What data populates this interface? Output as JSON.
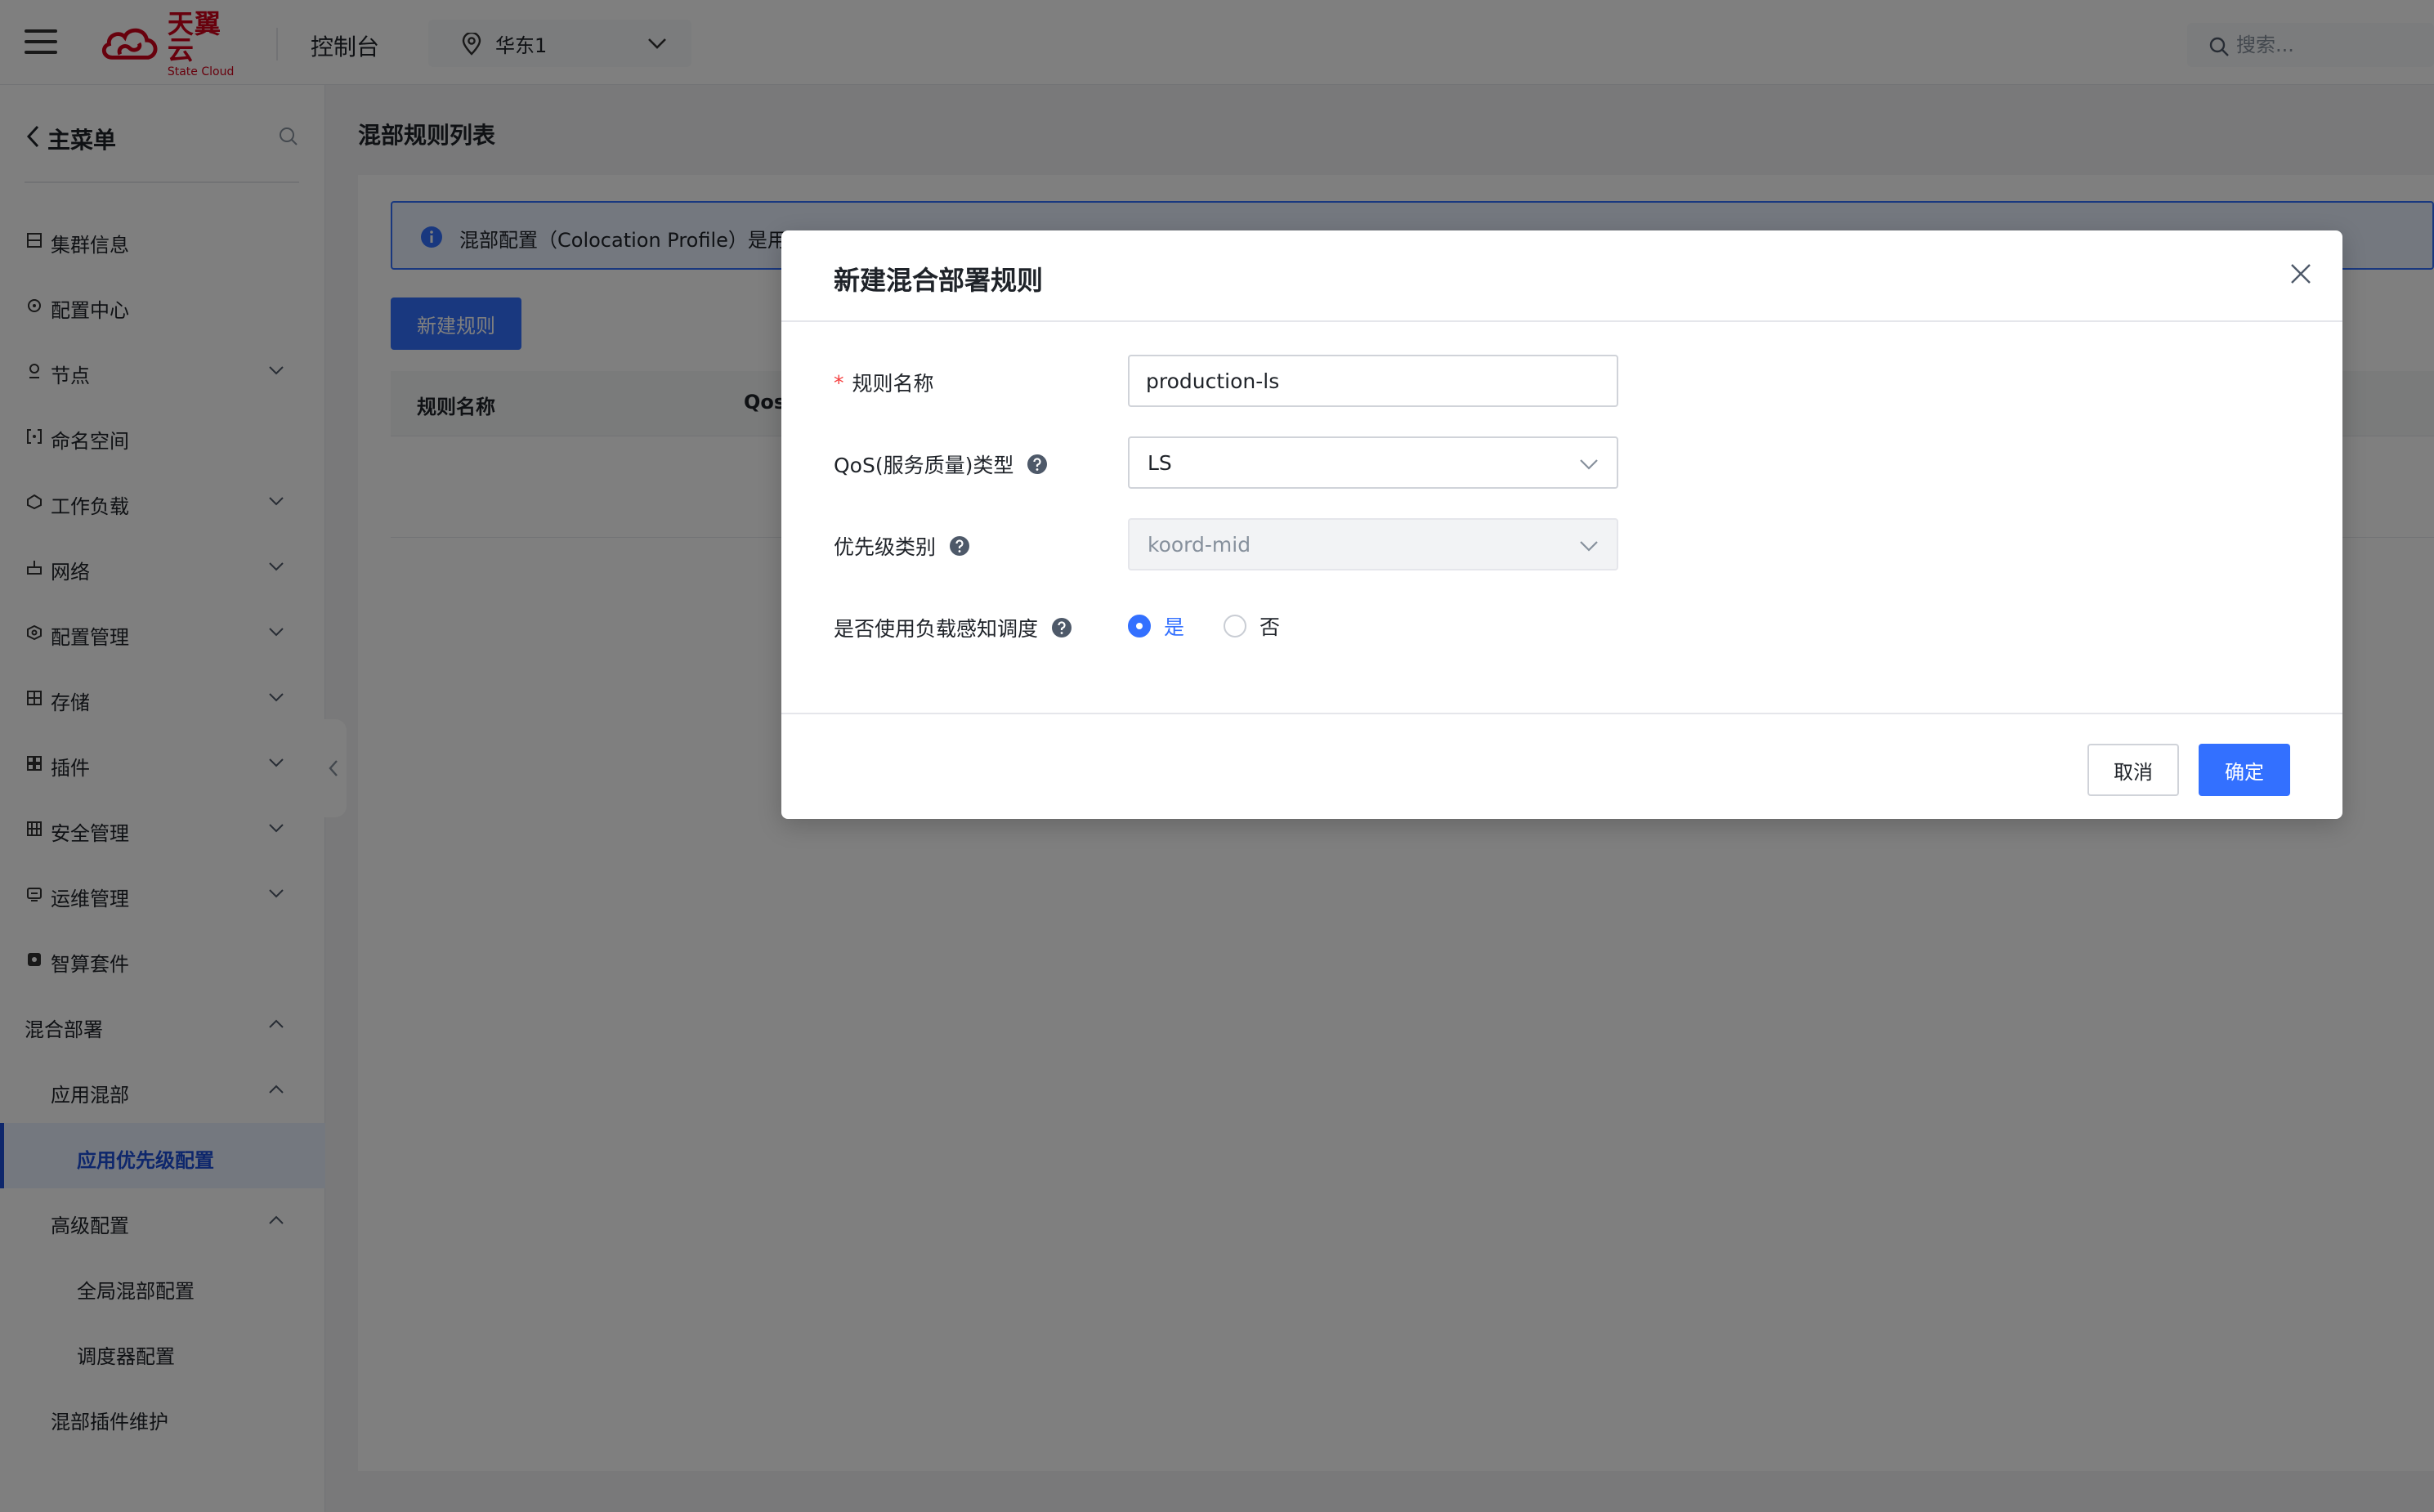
{
  "header": {
    "logo_cn": "天翼云",
    "logo_en": "State Cloud",
    "console_title": "控制台",
    "region": "华东1",
    "search_placeholder": "搜索..."
  },
  "sidebar": {
    "back_label": "主菜单",
    "items": [
      {
        "label": "集群信息",
        "icon": "cluster-icon",
        "expandable": false
      },
      {
        "label": "配置中心",
        "icon": "config-center-icon",
        "expandable": false
      },
      {
        "label": "节点",
        "icon": "node-icon",
        "expandable": true
      },
      {
        "label": "命名空间",
        "icon": "namespace-icon",
        "expandable": false
      },
      {
        "label": "工作负载",
        "icon": "workload-icon",
        "expandable": true
      },
      {
        "label": "网络",
        "icon": "network-icon",
        "expandable": true
      },
      {
        "label": "配置管理",
        "icon": "config-manage-icon",
        "expandable": true
      },
      {
        "label": "存储",
        "icon": "storage-icon",
        "expandable": true
      },
      {
        "label": "插件",
        "icon": "plugin-icon",
        "expandable": true
      },
      {
        "label": "安全管理",
        "icon": "security-icon",
        "expandable": true
      },
      {
        "label": "运维管理",
        "icon": "ops-icon",
        "expandable": true
      },
      {
        "label": "智算套件",
        "icon": "ai-suite-icon",
        "expandable": false
      },
      {
        "label": "混合部署",
        "icon": "",
        "expandable": true,
        "expanded": true
      },
      {
        "label": "应用混部",
        "icon": "",
        "expandable": true,
        "expanded": true,
        "level": 2
      },
      {
        "label": "应用优先级配置",
        "icon": "",
        "level": 3,
        "active": true
      },
      {
        "label": "高级配置",
        "icon": "",
        "expandable": true,
        "expanded": true,
        "level": 2
      },
      {
        "label": "全局混部配置",
        "icon": "",
        "level": 3
      },
      {
        "label": "调度器配置",
        "icon": "",
        "level": 3
      },
      {
        "label": "混部插件维护",
        "icon": "",
        "level": 2
      }
    ]
  },
  "main": {
    "page_title": "混部规则列表",
    "info_banner": "混部配置（Colocation Profile）是用",
    "new_rule_button": "新建规则",
    "table_columns": [
      "规则名称",
      "Qos"
    ]
  },
  "modal": {
    "title": "新建混合部署规则",
    "fields": {
      "rule_name_label": "规则名称",
      "rule_name_value": "production-ls",
      "qos_label": "QoS(服务质量)类型",
      "qos_value": "LS",
      "priority_label": "优先级类别",
      "priority_value": "koord-mid",
      "load_aware_label": "是否使用负载感知调度",
      "radio_yes": "是",
      "radio_no": "否",
      "radio_selected": "是"
    },
    "cancel_button": "取消",
    "ok_button": "确定"
  },
  "colors": {
    "primary": "#3370ff",
    "brand_red": "#d0021b",
    "active_nav": "#1d4ed8",
    "required": "#f53f3f"
  }
}
